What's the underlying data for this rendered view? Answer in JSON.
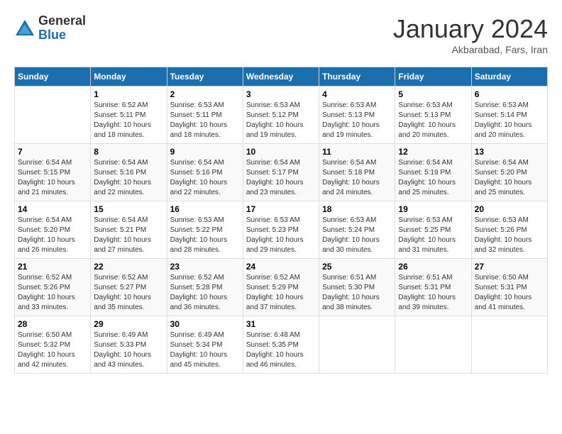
{
  "logo": {
    "general": "General",
    "blue": "Blue"
  },
  "title": "January 2024",
  "subtitle": "Akbarabad, Fars, Iran",
  "days_of_week": [
    "Sunday",
    "Monday",
    "Tuesday",
    "Wednesday",
    "Thursday",
    "Friday",
    "Saturday"
  ],
  "weeks": [
    [
      {
        "num": "",
        "detail": ""
      },
      {
        "num": "1",
        "detail": "Sunrise: 6:52 AM\nSunset: 5:11 PM\nDaylight: 10 hours\nand 18 minutes."
      },
      {
        "num": "2",
        "detail": "Sunrise: 6:53 AM\nSunset: 5:11 PM\nDaylight: 10 hours\nand 18 minutes."
      },
      {
        "num": "3",
        "detail": "Sunrise: 6:53 AM\nSunset: 5:12 PM\nDaylight: 10 hours\nand 19 minutes."
      },
      {
        "num": "4",
        "detail": "Sunrise: 6:53 AM\nSunset: 5:13 PM\nDaylight: 10 hours\nand 19 minutes."
      },
      {
        "num": "5",
        "detail": "Sunrise: 6:53 AM\nSunset: 5:13 PM\nDaylight: 10 hours\nand 20 minutes."
      },
      {
        "num": "6",
        "detail": "Sunrise: 6:53 AM\nSunset: 5:14 PM\nDaylight: 10 hours\nand 20 minutes."
      }
    ],
    [
      {
        "num": "7",
        "detail": "Sunrise: 6:54 AM\nSunset: 5:15 PM\nDaylight: 10 hours\nand 21 minutes."
      },
      {
        "num": "8",
        "detail": "Sunrise: 6:54 AM\nSunset: 5:16 PM\nDaylight: 10 hours\nand 22 minutes."
      },
      {
        "num": "9",
        "detail": "Sunrise: 6:54 AM\nSunset: 5:16 PM\nDaylight: 10 hours\nand 22 minutes."
      },
      {
        "num": "10",
        "detail": "Sunrise: 6:54 AM\nSunset: 5:17 PM\nDaylight: 10 hours\nand 23 minutes."
      },
      {
        "num": "11",
        "detail": "Sunrise: 6:54 AM\nSunset: 5:18 PM\nDaylight: 10 hours\nand 24 minutes."
      },
      {
        "num": "12",
        "detail": "Sunrise: 6:54 AM\nSunset: 5:19 PM\nDaylight: 10 hours\nand 25 minutes."
      },
      {
        "num": "13",
        "detail": "Sunrise: 6:54 AM\nSunset: 5:20 PM\nDaylight: 10 hours\nand 25 minutes."
      }
    ],
    [
      {
        "num": "14",
        "detail": "Sunrise: 6:54 AM\nSunset: 5:20 PM\nDaylight: 10 hours\nand 26 minutes."
      },
      {
        "num": "15",
        "detail": "Sunrise: 6:54 AM\nSunset: 5:21 PM\nDaylight: 10 hours\nand 27 minutes."
      },
      {
        "num": "16",
        "detail": "Sunrise: 6:53 AM\nSunset: 5:22 PM\nDaylight: 10 hours\nand 28 minutes."
      },
      {
        "num": "17",
        "detail": "Sunrise: 6:53 AM\nSunset: 5:23 PM\nDaylight: 10 hours\nand 29 minutes."
      },
      {
        "num": "18",
        "detail": "Sunrise: 6:53 AM\nSunset: 5:24 PM\nDaylight: 10 hours\nand 30 minutes."
      },
      {
        "num": "19",
        "detail": "Sunrise: 6:53 AM\nSunset: 5:25 PM\nDaylight: 10 hours\nand 31 minutes."
      },
      {
        "num": "20",
        "detail": "Sunrise: 6:53 AM\nSunset: 5:26 PM\nDaylight: 10 hours\nand 32 minutes."
      }
    ],
    [
      {
        "num": "21",
        "detail": "Sunrise: 6:52 AM\nSunset: 5:26 PM\nDaylight: 10 hours\nand 33 minutes."
      },
      {
        "num": "22",
        "detail": "Sunrise: 6:52 AM\nSunset: 5:27 PM\nDaylight: 10 hours\nand 35 minutes."
      },
      {
        "num": "23",
        "detail": "Sunrise: 6:52 AM\nSunset: 5:28 PM\nDaylight: 10 hours\nand 36 minutes."
      },
      {
        "num": "24",
        "detail": "Sunrise: 6:52 AM\nSunset: 5:29 PM\nDaylight: 10 hours\nand 37 minutes."
      },
      {
        "num": "25",
        "detail": "Sunrise: 6:51 AM\nSunset: 5:30 PM\nDaylight: 10 hours\nand 38 minutes."
      },
      {
        "num": "26",
        "detail": "Sunrise: 6:51 AM\nSunset: 5:31 PM\nDaylight: 10 hours\nand 39 minutes."
      },
      {
        "num": "27",
        "detail": "Sunrise: 6:50 AM\nSunset: 5:31 PM\nDaylight: 10 hours\nand 41 minutes."
      }
    ],
    [
      {
        "num": "28",
        "detail": "Sunrise: 6:50 AM\nSunset: 5:32 PM\nDaylight: 10 hours\nand 42 minutes."
      },
      {
        "num": "29",
        "detail": "Sunrise: 6:49 AM\nSunset: 5:33 PM\nDaylight: 10 hours\nand 43 minutes."
      },
      {
        "num": "30",
        "detail": "Sunrise: 6:49 AM\nSunset: 5:34 PM\nDaylight: 10 hours\nand 45 minutes."
      },
      {
        "num": "31",
        "detail": "Sunrise: 6:48 AM\nSunset: 5:35 PM\nDaylight: 10 hours\nand 46 minutes."
      },
      {
        "num": "",
        "detail": ""
      },
      {
        "num": "",
        "detail": ""
      },
      {
        "num": "",
        "detail": ""
      }
    ]
  ]
}
